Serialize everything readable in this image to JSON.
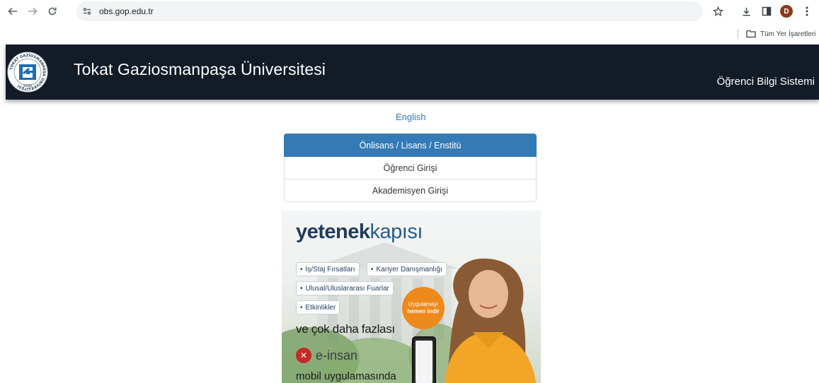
{
  "browser": {
    "url": "obs.gop.edu.tr",
    "bookmarks_all_label": "Tüm Yer İşaretleri",
    "avatar_letter": "D"
  },
  "header": {
    "title": "Tokat Gaziosmanpaşa Üniversitesi",
    "subtitle": "Öğrenci Bilgi Sistemi",
    "logo_year": "1992",
    "logo_ring_text": "TOKAT GAZİOSMANPAŞA ÜNİVERSİTESİ"
  },
  "language_link": "English",
  "login_panel": {
    "heading": "Önlisans / Lisans / Enstitü",
    "items": [
      "Öğrenci Girişi",
      "Akademisyen Girişi"
    ]
  },
  "banner": {
    "brand_bold": "yetenek",
    "brand_light": "kapısı",
    "tags": [
      "İş/Staj Fırsatları",
      "Kariyer Danışmanlığı",
      "Ulusal/Uluslararası Fuarlar",
      "Etkinlikler"
    ],
    "more": "ve çok daha fazlası",
    "bubble_line1": "Uygulamayı",
    "bubble_line2": "hemen indir",
    "app_name": "e-insan",
    "app_caption": "mobil uygulamasında"
  },
  "colors": {
    "header_bg": "#131b27",
    "panel_accent": "#337ab7",
    "link": "#337ab7",
    "bubble": "#ee8a1c"
  }
}
